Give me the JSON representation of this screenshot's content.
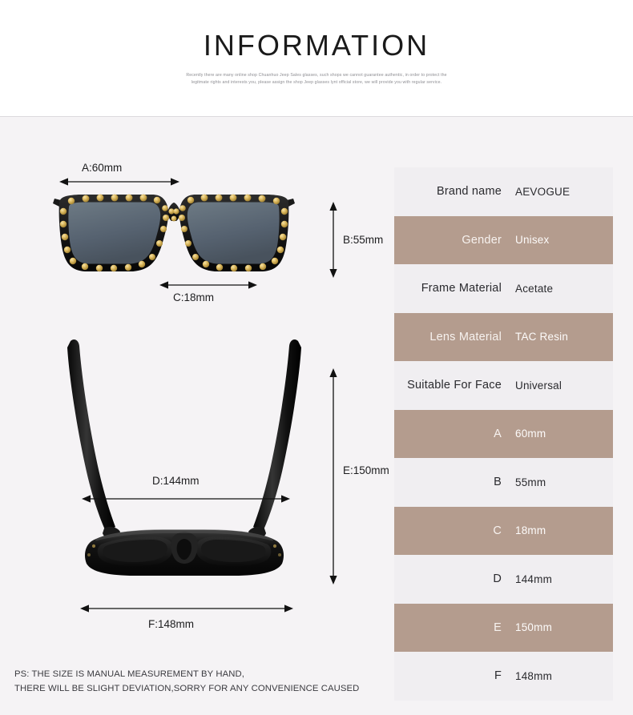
{
  "header": {
    "title": "INFORMATION",
    "subtitle": "Recently there are many online shop Chuanhuo Jeep Sales glasses, such shops we cannot guarantee authentic, in order to protect the legitmate rights and interests you, please assign the shop Jeep glasses lynt official store, we will provide you with regular service."
  },
  "diagram": {
    "front_view_name": "sunglasses-front-view",
    "top_view_name": "sunglasses-top-view",
    "dimensions": {
      "a": "A:60mm",
      "b": "B:55mm",
      "c": "C:18mm",
      "d": "D:144mm",
      "e": "E:150mm",
      "f": "F:148mm"
    }
  },
  "spec_table": {
    "rows": [
      {
        "key": "Brand name",
        "value": "AEVOGUE",
        "shade": "light"
      },
      {
        "key": "Gender",
        "value": "Unisex",
        "shade": "dark"
      },
      {
        "key": "Frame Material",
        "value": "Acetate",
        "shade": "light"
      },
      {
        "key": "Lens Material",
        "value": "TAC Resin",
        "shade": "dark"
      },
      {
        "key": "Suitable For Face",
        "value": "Universal",
        "shade": "light"
      },
      {
        "key": "A",
        "value": "60mm",
        "shade": "dark"
      },
      {
        "key": "B",
        "value": "55mm",
        "shade": "light"
      },
      {
        "key": "C",
        "value": "18mm",
        "shade": "dark"
      },
      {
        "key": "D",
        "value": "144mm",
        "shade": "light"
      },
      {
        "key": "E",
        "value": "150mm",
        "shade": "dark"
      },
      {
        "key": "F",
        "value": "148mm",
        "shade": "light"
      }
    ]
  },
  "footnote": {
    "line1": "PS: THE SIZE IS MANUAL MEASUREMENT BY HAND,",
    "line2": "THERE WILL BE SLIGHT DEVIATION,SORRY FOR ANY CONVENIENCE CAUSED"
  },
  "colors": {
    "page_background": "#f5f3f5",
    "header_background": "#ffffff",
    "row_light": "#f0eef1",
    "row_dark": "#b49c8e",
    "frame_black": "#141414",
    "lens_gray": "#5a6670",
    "stud_gold": "#d8b25a",
    "text_dark": "#1d1d1f"
  }
}
